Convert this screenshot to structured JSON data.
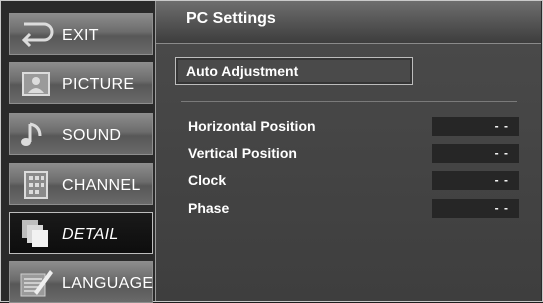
{
  "menu": {
    "items": [
      {
        "label": "EXIT",
        "icon": "exit-icon"
      },
      {
        "label": "PICTURE",
        "icon": "picture-icon"
      },
      {
        "label": "SOUND",
        "icon": "sound-icon"
      },
      {
        "label": "CHANNEL",
        "icon": "channel-icon"
      },
      {
        "label": "DETAIL",
        "icon": "detail-icon",
        "active": true
      },
      {
        "label": "LANGUAGE",
        "icon": "language-icon"
      }
    ]
  },
  "panel": {
    "title": "PC Settings",
    "auto_adjustment_label": "Auto Adjustment",
    "rows": [
      {
        "label": "Horizontal Position",
        "value": "- -"
      },
      {
        "label": "Vertical Position",
        "value": "- -"
      },
      {
        "label": "Clock",
        "value": "- -"
      },
      {
        "label": "Phase",
        "value": "- -"
      }
    ]
  },
  "colors": {
    "menu_gradient_top": "#8c8c8c",
    "active_menu": "#111111",
    "panel_bg": "#454545",
    "value_box": "#262626",
    "text": "#ffffff"
  }
}
